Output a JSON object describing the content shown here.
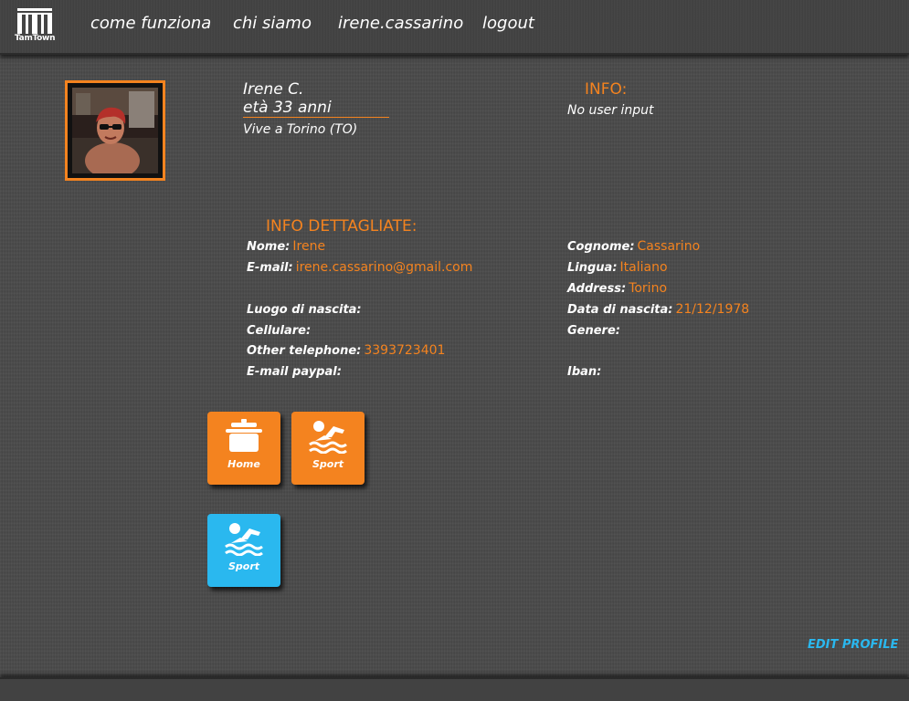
{
  "header": {
    "logo_text": "TamTown",
    "nav": [
      "come funziona",
      "chi siamo",
      "irene.cassarino",
      "logout"
    ]
  },
  "profile": {
    "name": "Irene C.",
    "age": "età 33 anni",
    "location": "Vive a Torino (TO)"
  },
  "info": {
    "title": "INFO:",
    "value": "No user input"
  },
  "details": {
    "title": "INFO DETTAGLIATE:",
    "left": [
      {
        "label": "Nome:",
        "value": "Irene"
      },
      {
        "label": "E-mail:",
        "value": "irene.cassarino@gmail.com"
      },
      {
        "label": "Luogo di nascita:",
        "value": ""
      },
      {
        "label": "Cellulare:",
        "value": ""
      },
      {
        "label": "Other telephone:",
        "value": "3393723401"
      },
      {
        "label": "E-mail paypal:",
        "value": ""
      }
    ],
    "right": [
      {
        "label": "Cognome:",
        "value": "Cassarino"
      },
      {
        "label": "Lingua:",
        "value": "Italiano"
      },
      {
        "label": "Address:",
        "value": "Torino"
      },
      {
        "label": "Data di nascita:",
        "value": "21/12/1978"
      },
      {
        "label": "Genere:",
        "value": ""
      },
      {
        "label": "Iban:",
        "value": ""
      }
    ]
  },
  "tiles": [
    {
      "label": "Home",
      "icon": "cooking-pot-icon",
      "color": "#f4831f"
    },
    {
      "label": "Sport",
      "icon": "swimmer-icon",
      "color": "#f4831f"
    },
    {
      "label": "Sport",
      "icon": "swimmer-icon",
      "color": "#2ab8ef"
    }
  ],
  "edit_profile": "EDIT PROFILE",
  "colors": {
    "accent": "#f4831f",
    "link": "#2ab8ef",
    "background": "#4a4a4a"
  }
}
